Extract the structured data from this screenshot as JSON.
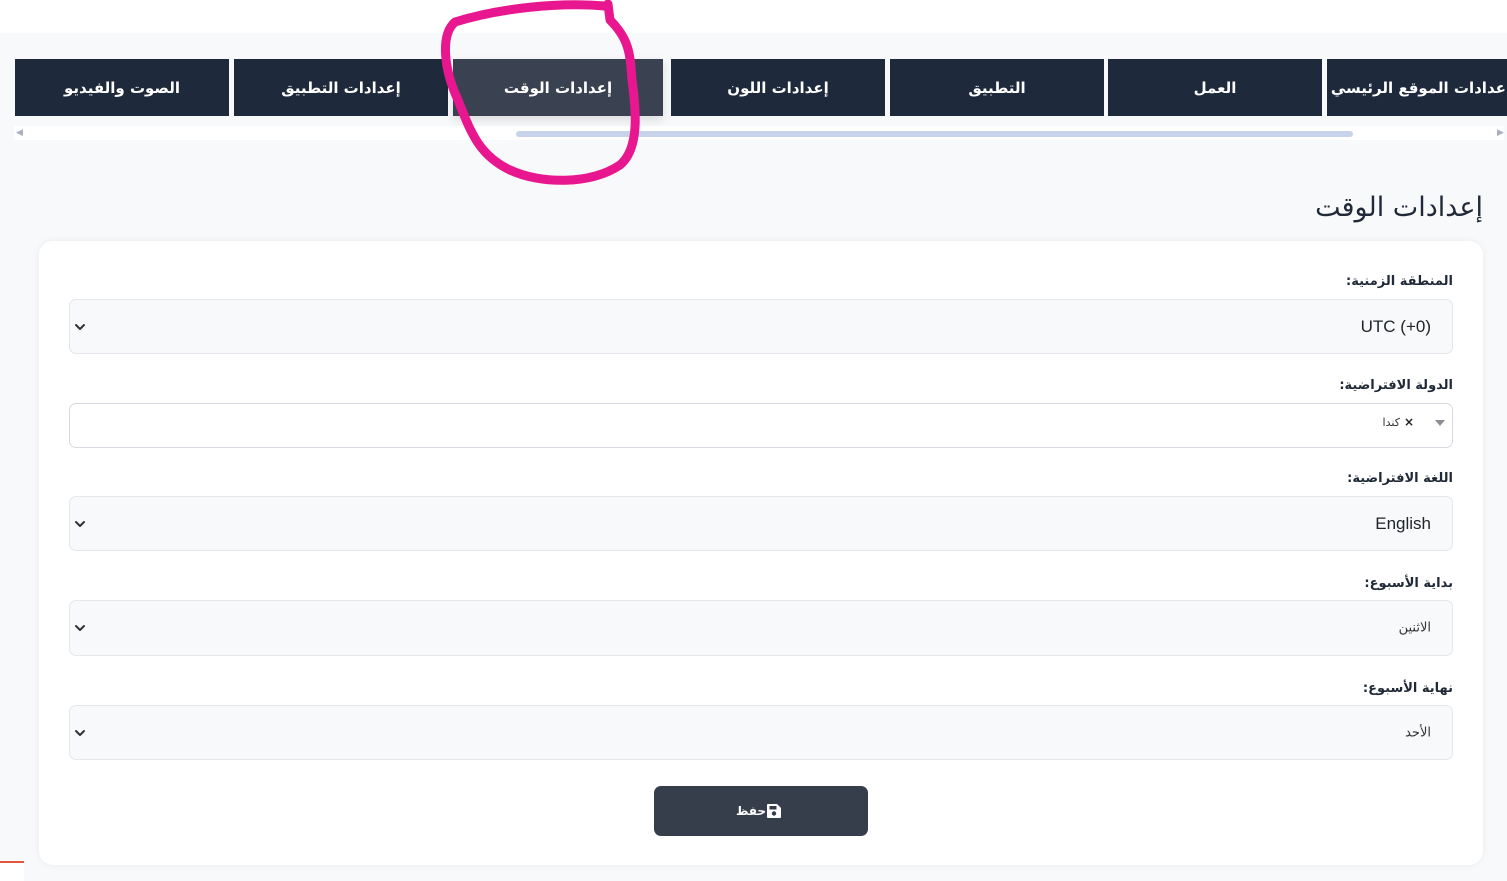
{
  "tabs": [
    {
      "label": "الصوت والفيديو"
    },
    {
      "label": "إعدادات التطبيق"
    },
    {
      "label": "إعدادات الوقت"
    },
    {
      "label": "إعدادات اللون"
    },
    {
      "label": "التطبيق"
    },
    {
      "label": "العمل"
    },
    {
      "label": "إعدادات الموقع الرئيسي"
    }
  ],
  "active_tab": "إعدادات الوقت",
  "page_title": "إعدادات الوقت",
  "form": {
    "timezone": {
      "label": "المنطقة الزمنية:",
      "value": "UTC (+0)"
    },
    "default_country": {
      "label": "الدولة الافتراضية:",
      "value": "كندا",
      "remove_glyph": "×"
    },
    "default_language": {
      "label": "اللغة الافتراضية:",
      "value": "English"
    },
    "week_start": {
      "label": "بداية الأسبوع:",
      "value": "الاثنين"
    },
    "weekend": {
      "label": "نهاية الأسبوع:",
      "value": "الأحد"
    }
  },
  "save_button": {
    "label": "حفظ",
    "icon": "floppy-disk-icon"
  },
  "colors": {
    "tab_bg": "#1e293b",
    "tab_active_bg": "#3a4150",
    "annotation": "#e8178f",
    "button_bg": "#363d4b"
  }
}
